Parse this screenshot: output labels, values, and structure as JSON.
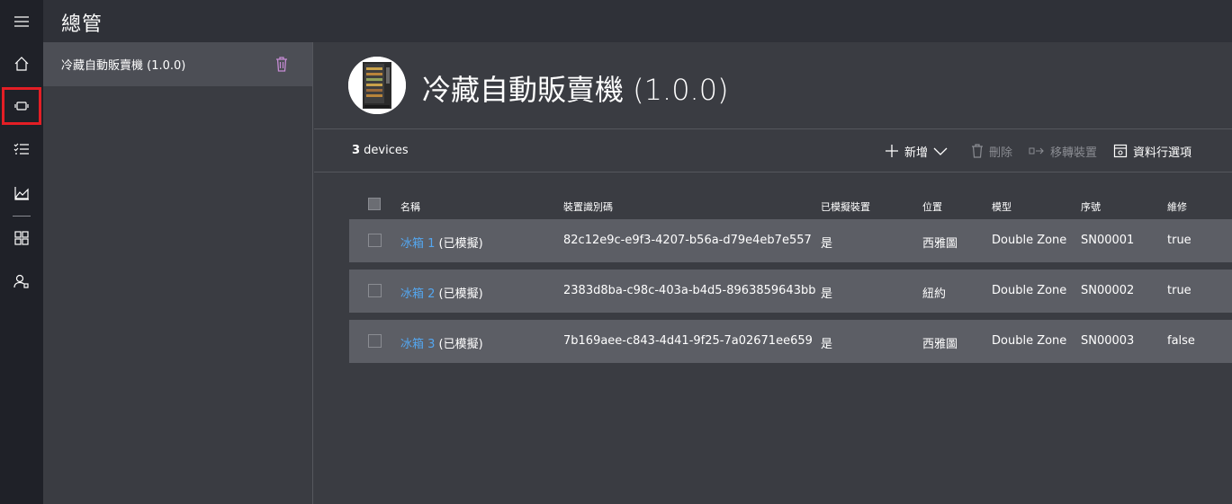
{
  "app": {
    "title": "總管"
  },
  "rail": {
    "items": [
      {
        "icon": "hamburger-icon"
      },
      {
        "icon": "home-icon"
      },
      {
        "icon": "device-icon",
        "selected": true
      },
      {
        "icon": "rules-icon"
      },
      {
        "icon": "analytics-icon"
      },
      {
        "icon": "dashboard-icon"
      },
      {
        "icon": "user-admin-icon"
      }
    ]
  },
  "templates": {
    "items": [
      {
        "label": "冷藏自動販賣機 (1.0.0)"
      }
    ]
  },
  "main": {
    "title": "冷藏自動販賣機 (1.0.0)",
    "count_number": "3",
    "count_suffix": " devices",
    "commands": {
      "new": "新增",
      "delete": "刪除",
      "migrate": "移轉裝置",
      "columns": "資料行選項"
    },
    "columns": [
      "名稱",
      "裝置識別碼",
      "已模擬裝置",
      "位置",
      "模型",
      "序號",
      "維修"
    ],
    "rows": [
      {
        "name_link": "冰箱 1",
        "name_suffix": " (已模擬)",
        "id": "82c12e9c-e9f3-4207-b56a-d79e4eb7e557",
        "simulated": "是",
        "location": "西雅圖",
        "model": "Double Zone",
        "serial": "SN00001",
        "maintenance": "true"
      },
      {
        "name_link": "冰箱 2",
        "name_suffix": " (已模擬)",
        "id": "2383d8ba-c98c-403a-b4d5-8963859643bb",
        "simulated": "是",
        "location": "紐約",
        "model": "Double Zone",
        "serial": "SN00002",
        "maintenance": "true"
      },
      {
        "name_link": "冰箱 3",
        "name_suffix": " (已模擬)",
        "id": "7b169aee-c843-4d41-9f25-7a02671ee659",
        "simulated": "是",
        "location": "西雅圖",
        "model": "Double Zone",
        "serial": "SN00003",
        "maintenance": "false"
      }
    ]
  },
  "colors": {
    "rail_bg": "#1f2128",
    "header_bg": "#2f3138",
    "content_bg": "#3a3c42",
    "row_bg": "#5c5e65",
    "link": "#54a6ef",
    "selected_outline": "#e31e25"
  }
}
